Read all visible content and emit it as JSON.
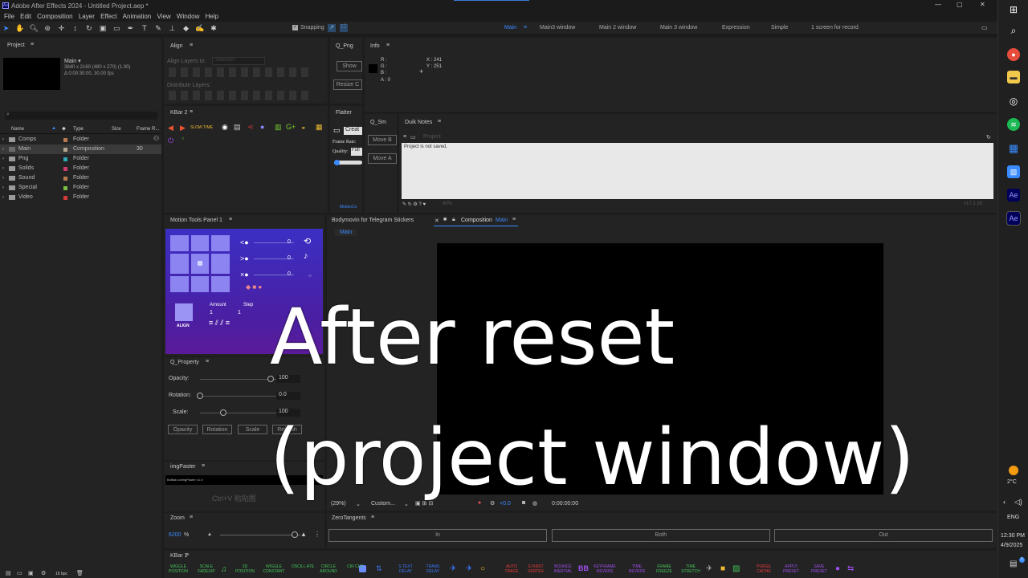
{
  "app": {
    "title": "Adobe After Effects 2024 - Untitled Project.aep *"
  },
  "menu": [
    "File",
    "Edit",
    "Composition",
    "Layer",
    "Effect",
    "Animation",
    "View",
    "Window",
    "Help"
  ],
  "toolbar": {
    "snapping": "Snapping"
  },
  "workspaces": [
    "Main",
    "Main3 window",
    "Main 2 window",
    "Main 3 window",
    "Expression",
    "Simple",
    "1 screen for record"
  ],
  "project": {
    "title": "Project",
    "comp_name": "Main ▾",
    "comp_info1": "3840 x 2160  (480 x 270) (1.00)",
    "comp_info2": "Δ 0:00:30:00, 30.00 fps",
    "columns": [
      "Name",
      "Type",
      "Size",
      "Frame R..."
    ],
    "items": [
      {
        "name": "Comps",
        "type": "Folder",
        "size": "",
        "fr": "",
        "color": "#b87b4e"
      },
      {
        "name": "Main",
        "type": "Composition",
        "size": "",
        "fr": "30",
        "color": "#b4a58c"
      },
      {
        "name": "Png",
        "type": "Folder",
        "size": "",
        "fr": "",
        "color": "#2ea8b5"
      },
      {
        "name": "Solids",
        "type": "Folder",
        "size": "",
        "fr": "",
        "color": "#d03a6b"
      },
      {
        "name": "Sound",
        "type": "Folder",
        "size": "",
        "fr": "",
        "color": "#b87b4e"
      },
      {
        "name": "Special",
        "type": "Folder",
        "size": "",
        "fr": "",
        "color": "#7ac043"
      },
      {
        "name": "Video",
        "type": "Folder",
        "size": "",
        "fr": "",
        "color": "#d43a3a"
      }
    ],
    "bottom_bpc": "16 bpc"
  },
  "align": {
    "title": "Align",
    "align_to": "Align Layers to:",
    "selection": "Selection",
    "distribute": "Distribute Layers:"
  },
  "qpng": {
    "title": "Q_Png",
    "show": "Show",
    "resize": "Resize C"
  },
  "info": {
    "title": "Info",
    "r": "R :",
    "g": "G :",
    "b": "B :",
    "a": "A :  0",
    "x": "X : 241",
    "y": "Y : 251"
  },
  "kbar2": {
    "title": "KBar 2",
    "slow_time": "SLOW TIME"
  },
  "flatter": {
    "title": "Flatter",
    "create": "Creat",
    "frame_rate": "Frame Rate:",
    "quality": "Quality:",
    "full": "Full",
    "motionco": "MotionCo"
  },
  "qsm": {
    "title": "Q_Sm",
    "move_b": "Move B",
    "move_a": "Move A"
  },
  "duik": {
    "title": "Duik Notes",
    "project": "Project",
    "text": "Project is not saved.",
    "zoom": "40%",
    "version": "v17.1.16"
  },
  "motiontools": {
    "title": "Motion Tools Panel 1",
    "val1": "0",
    "val2": "0",
    "val3": "0",
    "align": "ALIGN",
    "amount_label": "Amount",
    "step_label": "Step",
    "amount": "1",
    "step": "1"
  },
  "qproperty": {
    "title": "Q_Property",
    "opacity_label": "Opacity:",
    "rotation_label": "Rotation:",
    "scale_label": "Scale:",
    "opacity": "100",
    "rotation": "0.0",
    "scale": "100",
    "opacity_level": 0.84,
    "rotation_level": 0.0,
    "scale_level": 0.28,
    "btn_opacity": "Opacity",
    "btn_rotation": "Rotation",
    "btn_scale": "Scale",
    "btn_refresh": "Refresh"
  },
  "imgpaster": {
    "title": "imgPaster",
    "header": "Bottlab.io/imgPaster v1.0",
    "hint": "Ctrl+V 粘贴图"
  },
  "zoom": {
    "title": "Zoom",
    "value": "6200",
    "unit": "%",
    "level": 0.93
  },
  "viewer": {
    "tab1": "Bodymovin for Telegram Stickers",
    "tab2_prefix": "Composition",
    "tab2_name": "Main",
    "subtab": "Main",
    "zoom": "(29%)",
    "resolution": "Custom...",
    "exposure": "+0.0",
    "timecode": "0:00:00:00"
  },
  "zerotangents": {
    "title": "ZeroTangents",
    "in": "In",
    "both": "Both",
    "out": "Out"
  },
  "kbar1": {
    "title": "KBar 1",
    "items": [
      {
        "label": "WIGGLE POSITION",
        "color": "#44c65a"
      },
      {
        "label": "SCALE FADE/UP",
        "color": "#44c65a"
      },
      {
        "label": "3D POSITION",
        "color": "#44c65a"
      },
      {
        "label": "WIGGLE CONSTANT",
        "color": "#44c65a"
      },
      {
        "label": "OSCILL ATE",
        "color": "#44c65a"
      },
      {
        "label": "CIRCLE AROUND",
        "color": "#44c65a"
      },
      {
        "label": "CIR CLE",
        "color": "#44c65a"
      },
      {
        "label": "S TEXT DELAY",
        "color": "#3a78ff"
      },
      {
        "label": "TRANS DELAY",
        "color": "#3a78ff"
      },
      {
        "label": "AUTO TRACE",
        "color": "#ee3b3b"
      },
      {
        "label": "S FIRST VERTEX",
        "color": "#ee3b3b"
      },
      {
        "label": "BOUNCE INERTIAL",
        "color": "#a14ef3"
      },
      {
        "label": "KEYFRAME REVERS",
        "color": "#a14ef3"
      },
      {
        "label": "TIME REVERS",
        "color": "#a14ef3"
      },
      {
        "label": "FRAME FREEZE",
        "color": "#44c65a"
      },
      {
        "label": "TIME STRETCH",
        "color": "#44c65a"
      },
      {
        "label": "PURGE CACHE",
        "color": "#ee3b3b"
      },
      {
        "label": "APPLY PRESET",
        "color": "#a14ef3"
      },
      {
        "label": "SAVE PRESET",
        "color": "#a14ef3"
      }
    ]
  },
  "overlay": {
    "line1": "After reset",
    "line2": "(project window)"
  },
  "system": {
    "temp": "2°C",
    "lang": "ENG",
    "time": "12:30 PM",
    "date": "4/9/2025",
    "notif": "1"
  }
}
